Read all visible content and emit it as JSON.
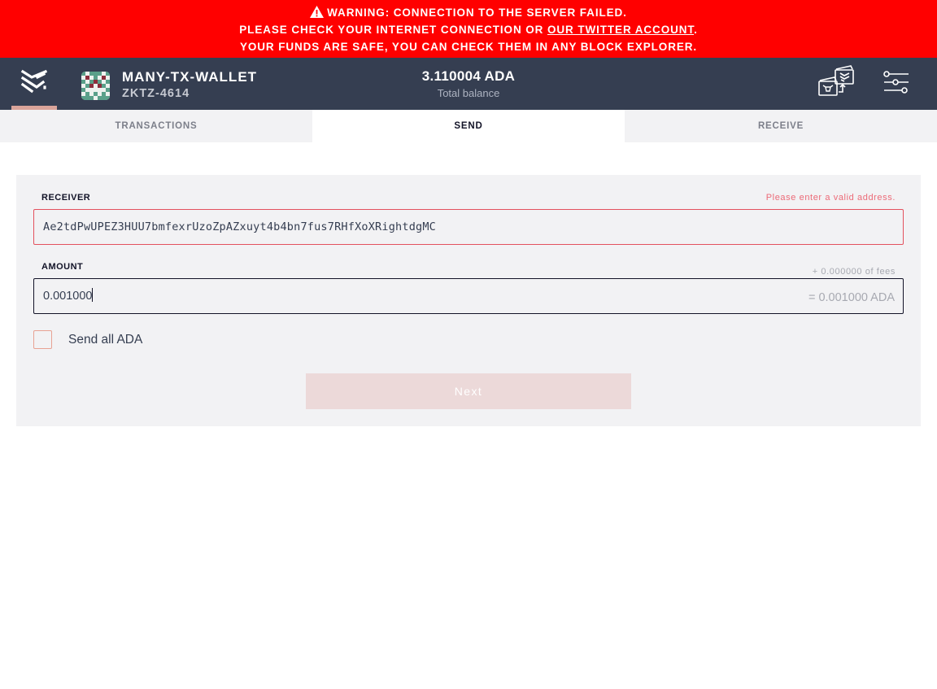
{
  "banner": {
    "line1": "WARNING: CONNECTION TO THE SERVER FAILED.",
    "line2_prefix": "PLEASE CHECK YOUR INTERNET CONNECTION OR ",
    "line2_link": "OUR TWITTER ACCOUNT",
    "line2_suffix": ".",
    "line3": "YOUR FUNDS ARE SAFE, YOU CAN CHECK THEM IN ANY BLOCK EXPLORER.",
    "icon": "warning-triangle-icon",
    "color": "#ff0000"
  },
  "topbar": {
    "logo_icon": "yoroi-logo-icon",
    "wallet_name": "MANY-TX-WALLET",
    "wallet_id": "ZKTZ-4614",
    "balance_amount": "3.110004 ADA",
    "balance_label": "Total balance",
    "icons": [
      "switch-wallet-icon",
      "settings-sliders-icon"
    ],
    "background": "#353e51",
    "accent": "#daa49a"
  },
  "tabs": [
    {
      "label": "TRANSACTIONS",
      "active": false
    },
    {
      "label": "SEND",
      "active": true
    },
    {
      "label": "RECEIVE",
      "active": false
    }
  ],
  "form": {
    "receiver_label": "RECEIVER",
    "receiver_error": "Please enter a valid address.",
    "receiver_value": "Ae2tdPwUPEZ3HUU7bmfexrUzoZpAZxuyt4b4bn7fus7RHfXoXRightdgMC",
    "amount_label": "AMOUNT",
    "fees_hint": "+ 0.000000 of fees",
    "amount_value": "0.001000",
    "amount_total": "= 0.001000 ADA",
    "send_all_label": "Send all ADA",
    "send_all_checked": false,
    "next_label": "Next",
    "next_disabled": true
  }
}
